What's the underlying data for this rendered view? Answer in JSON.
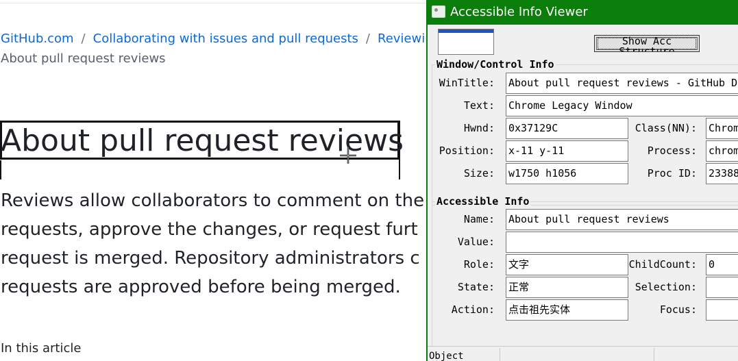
{
  "docs": {
    "breadcrumbs": [
      "GitHub.com",
      "Collaborating with issues and pull requests",
      "Reviewing"
    ],
    "separator": "/",
    "current": "About pull request reviews",
    "title": "About pull request reviews",
    "lead_lines": [
      "Reviews allow collaborators to comment on the",
      "requests, approve the changes, or request furt",
      "request is merged. Repository administrators c",
      "requests are approved before being merged."
    ],
    "toc_title": "In this article"
  },
  "viewer": {
    "title": "Accessible Info Viewer",
    "show_button": "Show Acc Structure",
    "window_group_title": "Window/Control Info",
    "accessible_group_title": "Accessible Info",
    "window": {
      "wintitle_label": "WinTitle:",
      "wintitle": "About pull request reviews - GitHub Do",
      "text_label": "Text:",
      "text": "Chrome Legacy Window",
      "hwnd_label": "Hwnd:",
      "hwnd": "0x37129C",
      "class_label": "Class(NN):",
      "class": "Chrom",
      "position_label": "Position:",
      "position": "x-11  y-11",
      "process_label": "Process:",
      "process": "chrom",
      "size_label": "Size:",
      "size": "w1750  h1056",
      "procid_label": "Proc ID:",
      "procid": "23388"
    },
    "accessible": {
      "name_label": "Name:",
      "name": "About pull request reviews",
      "value_label": "Value:",
      "value": "",
      "role_label": "Role:",
      "role": "文字",
      "childcount_label": "ChildCount:",
      "childcount": "0",
      "state_label": "State:",
      "state": "正常",
      "selection_label": "Selection:",
      "selection": "",
      "action_label": "Action:",
      "action": "点击祖先实体",
      "focus_label": "Focus:",
      "focus": ""
    },
    "status": "Object"
  },
  "colors": {
    "link": "#0969da",
    "titlebar": "#0b7d0b",
    "text": "#1f2328"
  }
}
